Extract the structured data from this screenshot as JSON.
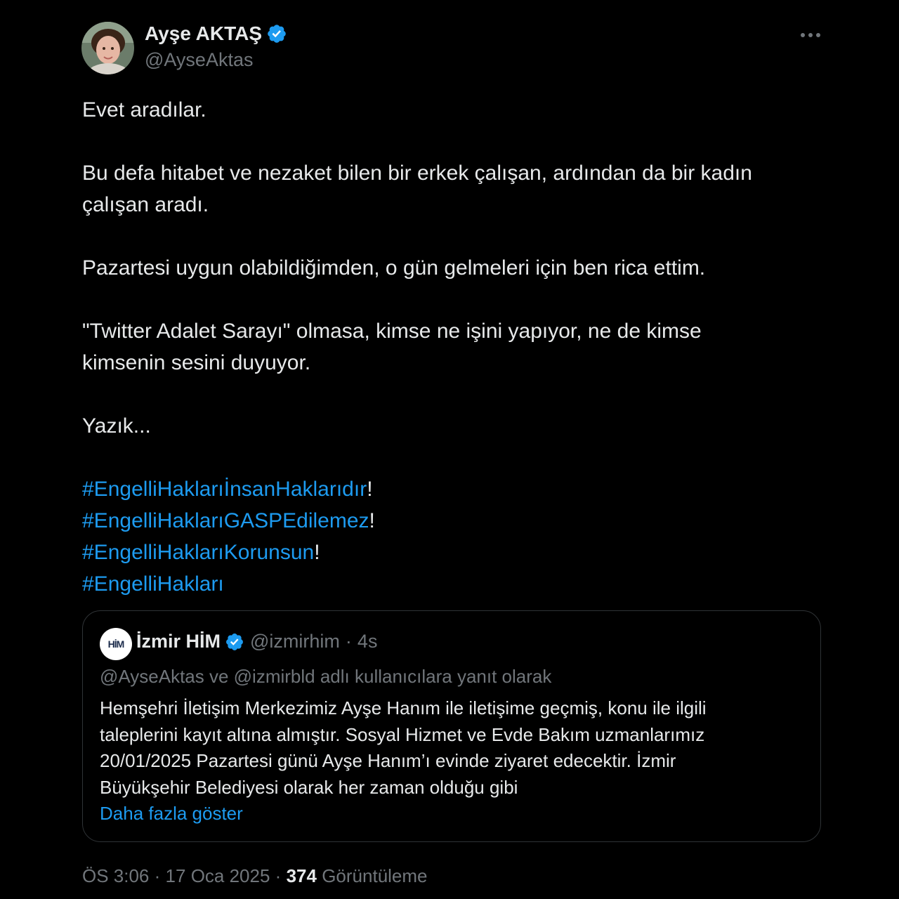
{
  "author": {
    "display_name": "Ayşe AKTAŞ",
    "handle": "@AyseAktas",
    "avatar_icon": "profile-photo",
    "verified_icon": "verified-badge-icon"
  },
  "tweet": {
    "paragraphs": [
      [
        "Evet aradılar."
      ],
      [
        "Bu defa hitabet ve nezaket bilen bir erkek çalışan, ardından da bir kadın",
        "çalışan aradı."
      ],
      [
        "Pazartesi uygun olabildiğimden, o gün gelmeleri için ben rica ettim."
      ],
      [
        "\"Twitter Adalet Sarayı\" olmasa, kimse ne işini yapıyor, ne de kimse",
        "kimsenin sesini duyuyor."
      ],
      [
        "Yazık..."
      ]
    ],
    "hashtags": [
      {
        "tag": "#EngelliHaklarıİnsanHaklarıdır",
        "suffix": "!"
      },
      {
        "tag": "#EngelliHaklarıGASPEdilemez",
        "suffix": "!"
      },
      {
        "tag": "#EngelliHaklarıKorunsun",
        "suffix": "!"
      },
      {
        "tag": "#EngelliHakları",
        "suffix": ""
      }
    ]
  },
  "quote": {
    "avatar_text": "HİM",
    "name": "İzmir HİM",
    "handle": "@izmirhim",
    "separator": "·",
    "time": "4s",
    "reply_to": "@AyseAktas ve @izmirbld adlı kullanıcılara yanıt olarak",
    "lines": [
      "Hemşehri İletişim Merkezimiz Ayşe Hanım ile iletişime geçmiş, konu ile ilgili",
      "taleplerini kayıt altına almıştır. Sosyal Hizmet ve Evde Bakım uzmanlarımız",
      "20/01/2025 Pazartesi günü Ayşe Hanım’ı evinde ziyaret edecektir. İzmir",
      "Büyükşehir Belediyesi olarak her zaman olduğu gibi"
    ],
    "show_more": "Daha fazla göster"
  },
  "meta": {
    "time": "ÖS 3:06",
    "separator": "·",
    "date": "17 Oca 2025",
    "views_count": "374",
    "views_label": "Görüntüleme"
  },
  "colors": {
    "background": "#000000",
    "text": "#e7e9ea",
    "muted": "#71767b",
    "link": "#1d9bf0",
    "border": "#2f3336"
  }
}
